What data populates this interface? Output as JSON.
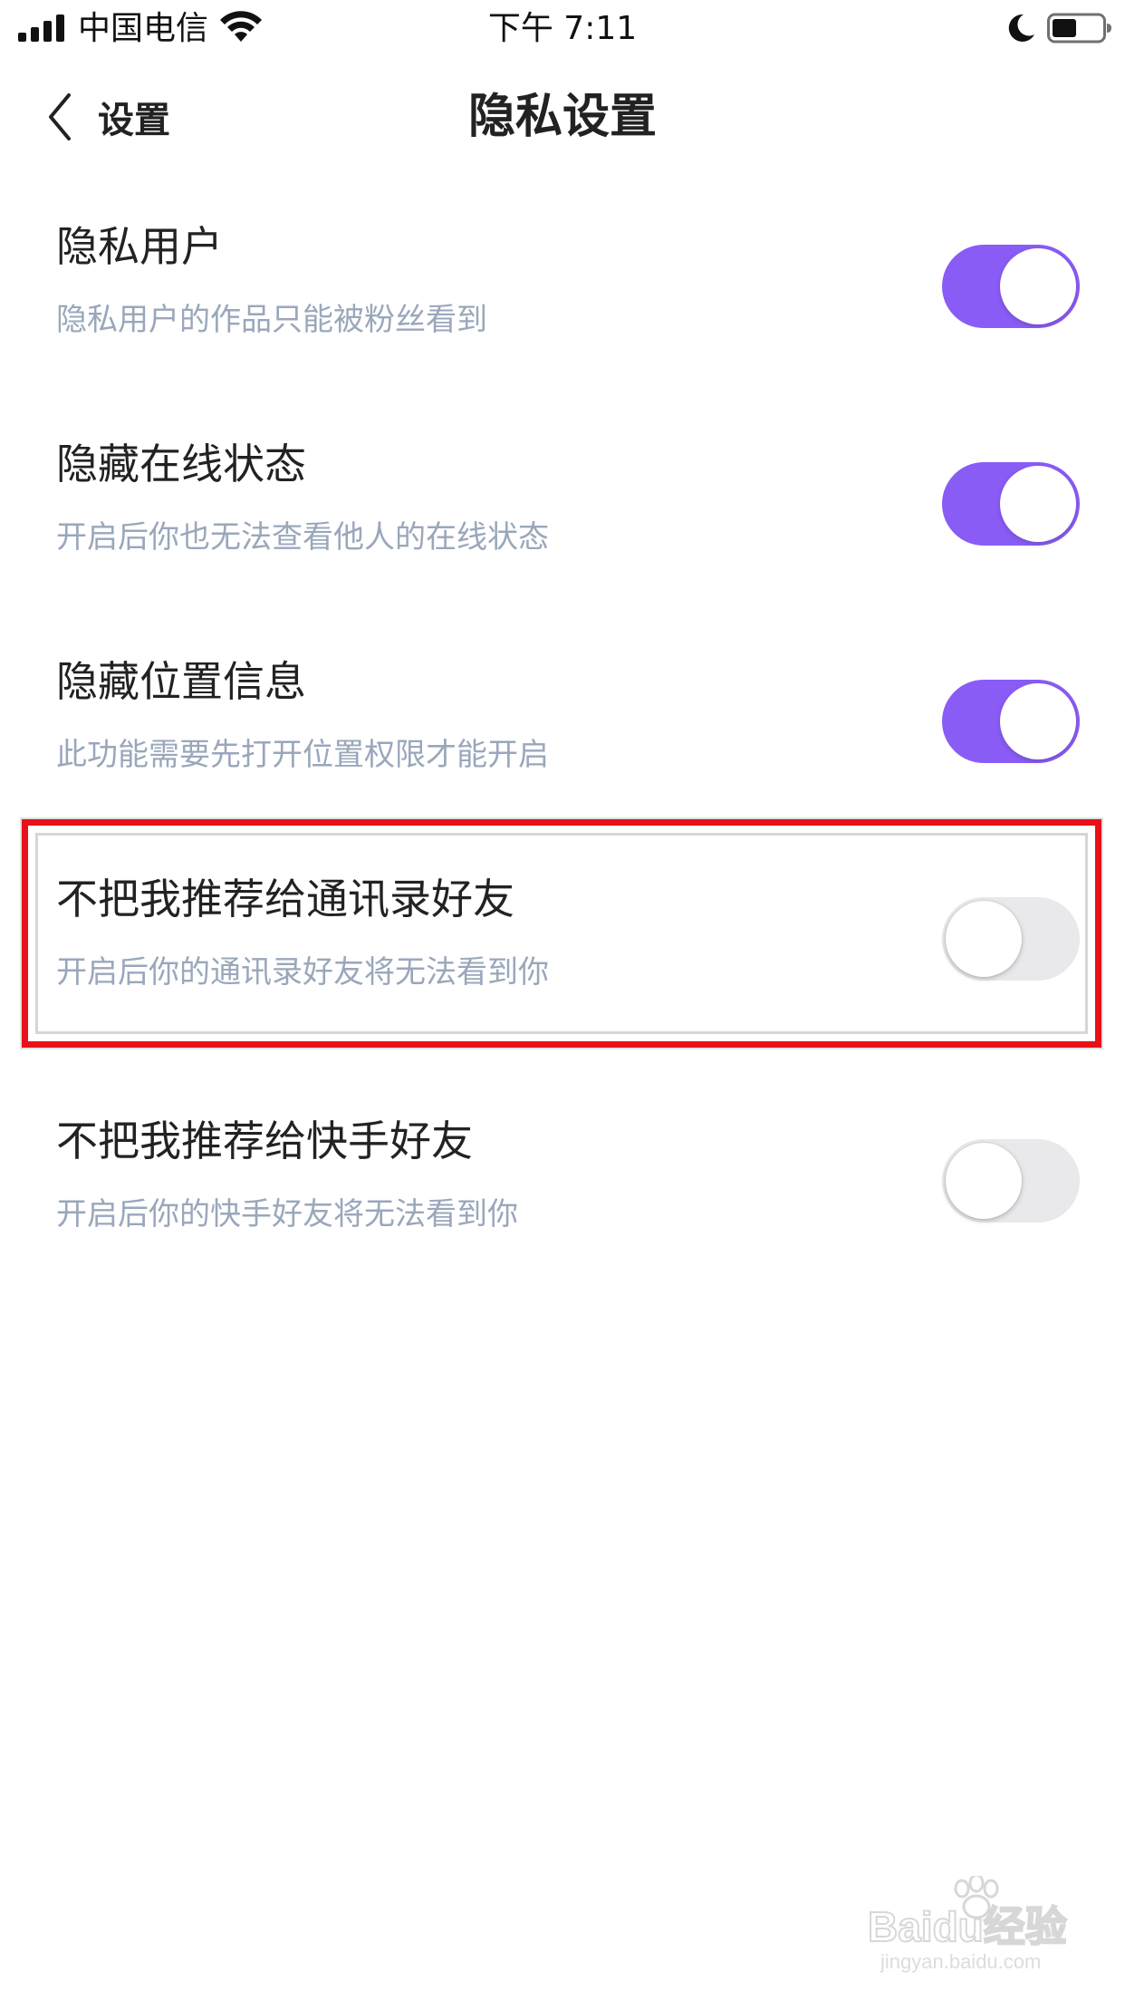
{
  "status_bar": {
    "carrier": "中国电信",
    "time": "下午 7:11"
  },
  "nav": {
    "back_label": "设置",
    "title": "隐私设置"
  },
  "settings": [
    {
      "title": "隐私用户",
      "description": "隐私用户的作品只能被粉丝看到",
      "enabled": true
    },
    {
      "title": "隐藏在线状态",
      "description": "开启后你也无法查看他人的在线状态",
      "enabled": true
    },
    {
      "title": "隐藏位置信息",
      "description": "此功能需要先打开位置权限才能开启",
      "enabled": true
    },
    {
      "title": "不把我推荐给通讯录好友",
      "description": "开启后你的通讯录好友将无法看到你",
      "enabled": false
    },
    {
      "title": "不把我推荐给快手好友",
      "description": "开启后你的快手好友将无法看到你",
      "enabled": false
    }
  ],
  "colors": {
    "toggle_on": "#8a5cf6",
    "toggle_off": "#e9e9eb",
    "highlight": "#e8101a",
    "description_text": "#9aa7bb"
  },
  "watermark": {
    "brand": "Baidu经验",
    "url": "jingyan.baidu.com"
  }
}
